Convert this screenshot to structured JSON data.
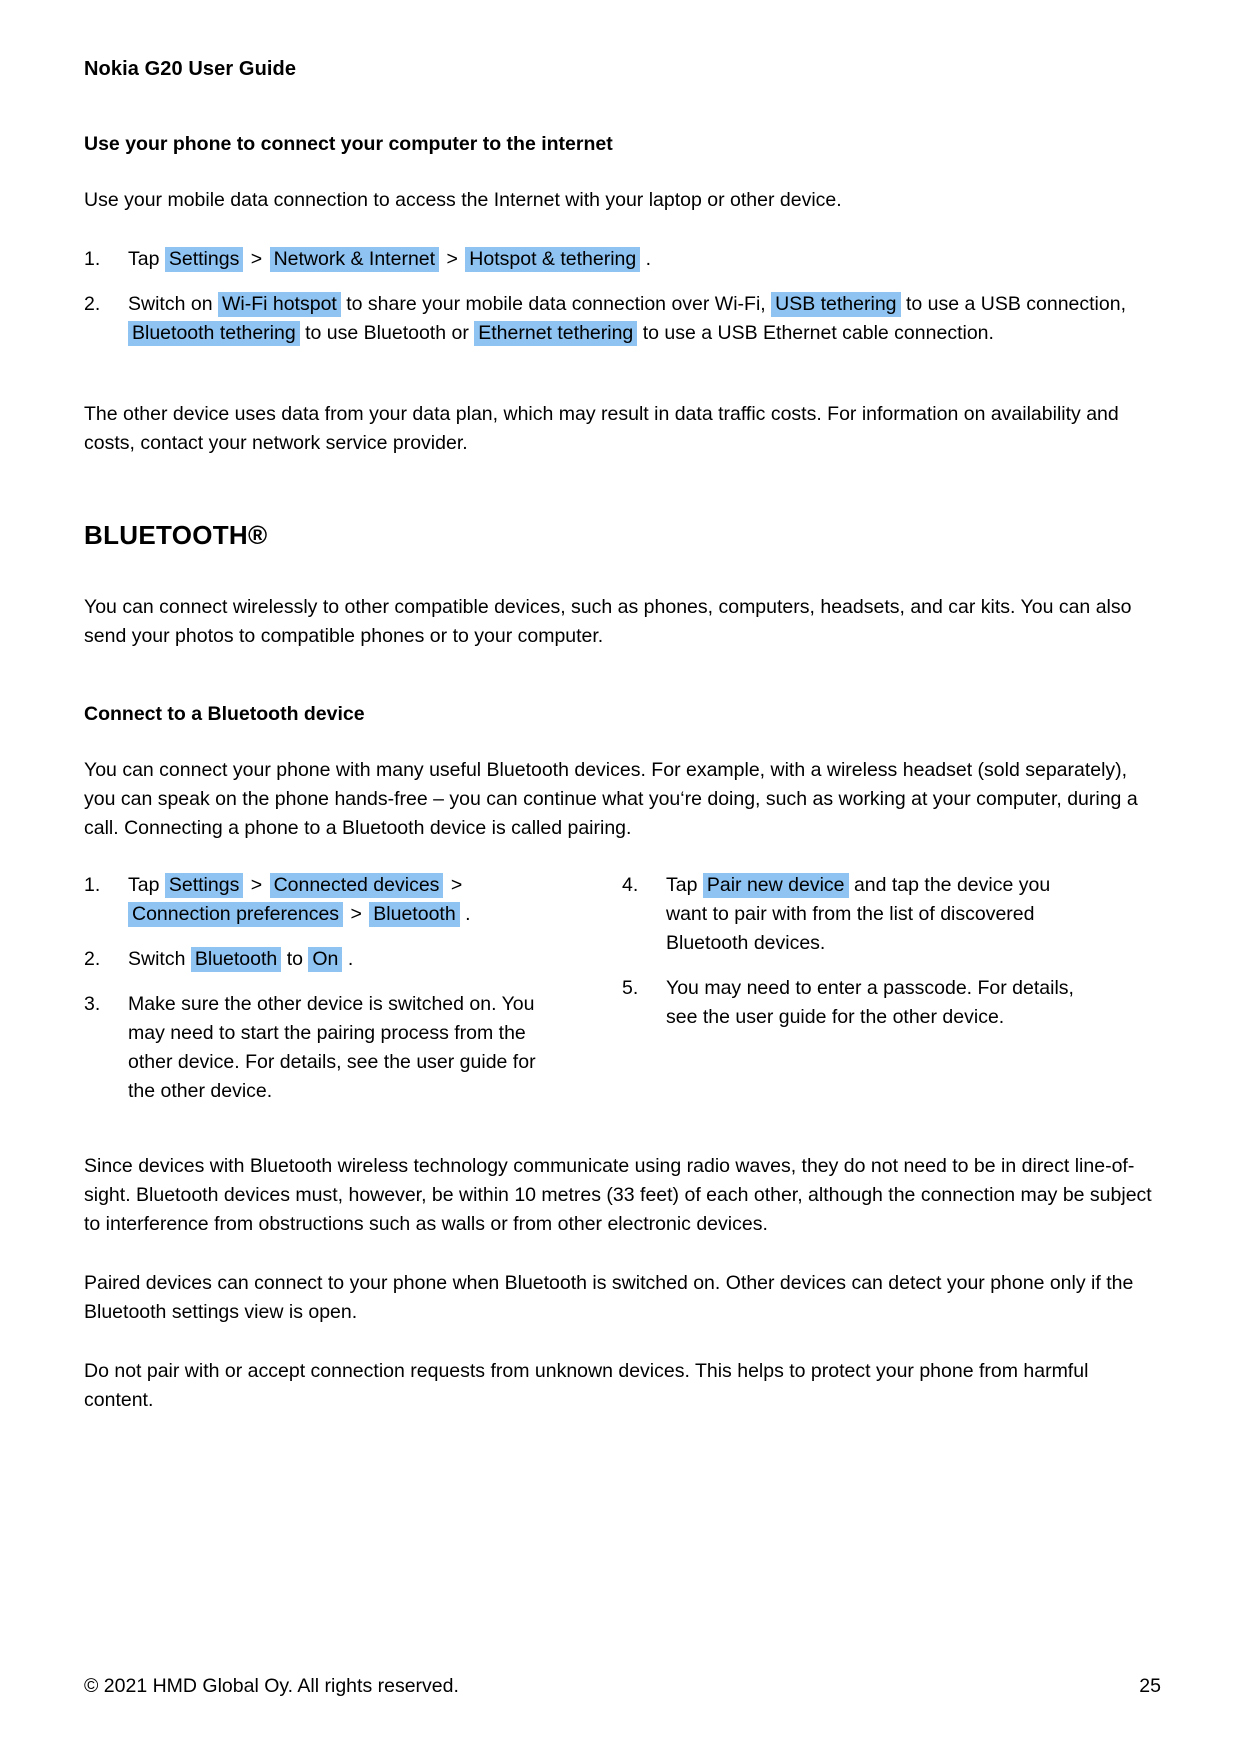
{
  "header": {
    "running_head": "Nokia G20 User Guide"
  },
  "hotspot_section": {
    "heading": "Use your phone to connect your computer to the internet",
    "intro": "Use your mobile data connection to access the Internet with your laptop or other device.",
    "steps": [
      {
        "num": "1.",
        "parts": [
          {
            "t": "text",
            "v": "Tap "
          },
          {
            "t": "hl",
            "v": "Settings"
          },
          {
            "t": "chev",
            "v": ">"
          },
          {
            "t": "hl",
            "v": "Network & Internet"
          },
          {
            "t": "chev",
            "v": ">"
          },
          {
            "t": "hl",
            "v": "Hotspot & tethering"
          },
          {
            "t": "text",
            "v": " ."
          }
        ]
      },
      {
        "num": "2.",
        "parts": [
          {
            "t": "text",
            "v": "Switch on "
          },
          {
            "t": "hl",
            "v": "Wi-Fi hotspot"
          },
          {
            "t": "text",
            "v": " to share your mobile data connection over Wi-Fi, "
          },
          {
            "t": "hl",
            "v": "USB tethering"
          },
          {
            "t": "text",
            "v": " to use a USB connection, "
          },
          {
            "t": "hl",
            "v": "Bluetooth tethering"
          },
          {
            "t": "text",
            "v": " to use Bluetooth or "
          },
          {
            "t": "hl",
            "v": "Ethernet tethering"
          },
          {
            "t": "text",
            "v": " to use a USB Ethernet cable connection."
          }
        ]
      }
    ],
    "note": "The other device uses data from your data plan, which may result in data traffic costs. For information on availability and costs, contact your network service provider."
  },
  "bluetooth_section": {
    "heading": "BLUETOOTH®",
    "intro": "You can connect wirelessly to other compatible devices, such as phones, computers, headsets, and car kits. You can also send your photos to compatible phones or to your computer.",
    "connect_heading": "Connect to a Bluetooth device",
    "connect_intro": "You can connect your phone with many useful Bluetooth devices. For example, with a wireless headset (sold separately), you can speak on the phone hands-free – you can continue what you‘re doing, such as working at your computer, during a call. Connecting a phone to a Bluetooth device is called pairing.",
    "steps_left": [
      {
        "num": "1.",
        "parts": [
          {
            "t": "text",
            "v": "Tap "
          },
          {
            "t": "hl",
            "v": "Settings"
          },
          {
            "t": "chev",
            "v": ">"
          },
          {
            "t": "hl",
            "v": "Connected devices"
          },
          {
            "t": "chev",
            "v": ">"
          },
          {
            "t": "hl",
            "v": "Connection preferences"
          },
          {
            "t": "chev",
            "v": ">"
          },
          {
            "t": "hl",
            "v": "Bluetooth"
          },
          {
            "t": "text",
            "v": " ."
          }
        ]
      },
      {
        "num": "2.",
        "parts": [
          {
            "t": "text",
            "v": "Switch "
          },
          {
            "t": "hl",
            "v": "Bluetooth"
          },
          {
            "t": "text",
            "v": " to "
          },
          {
            "t": "hl",
            "v": "On"
          },
          {
            "t": "text",
            "v": " ."
          }
        ]
      },
      {
        "num": "3.",
        "parts": [
          {
            "t": "text",
            "v": "Make sure the other device is switched on. You may need to start the pairing process from the other device. For details, see the user guide for the other device."
          }
        ]
      }
    ],
    "steps_right": [
      {
        "num": "4.",
        "parts": [
          {
            "t": "text",
            "v": "Tap "
          },
          {
            "t": "hl",
            "v": "Pair new device"
          },
          {
            "t": "text",
            "v": " and tap the device you want to pair with from the list of discovered Bluetooth devices."
          }
        ]
      },
      {
        "num": "5.",
        "parts": [
          {
            "t": "text",
            "v": "You may need to enter a passcode. For details, see the user guide for the other device."
          }
        ]
      }
    ],
    "para_radio": "Since devices with Bluetooth wireless technology communicate using radio waves, they do not need to be in direct line-of-sight. Bluetooth devices must, however, be within 10 metres (33 feet) of each other, although the connection may be subject to interference from obstructions such as walls or from other electronic devices.",
    "para_paired": "Paired devices can connect to your phone when Bluetooth is switched on. Other devices can detect your phone only if the Bluetooth settings view is open.",
    "para_warning": "Do not pair with or accept connection requests from unknown devices. This helps to protect your phone from harmful content."
  },
  "footer": {
    "copyright": "© 2021 HMD Global Oy. All rights reserved.",
    "page_number": "25"
  },
  "colors": {
    "highlight": "#8ec3f2",
    "text": "#000000",
    "background": "#ffffff"
  }
}
